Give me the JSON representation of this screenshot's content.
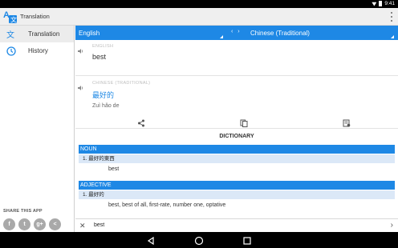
{
  "status": {
    "time": "9:41"
  },
  "app": {
    "title": "Translation"
  },
  "drawer": {
    "items": [
      {
        "label": "Translation",
        "icon": "translate-icon",
        "active": true
      },
      {
        "label": "History",
        "icon": "clock-icon",
        "active": false
      }
    ],
    "share_label": "SHARE THIS APP",
    "share_buttons": [
      {
        "icon": "facebook-icon",
        "glyph": "f"
      },
      {
        "icon": "twitter-icon",
        "glyph": "t"
      },
      {
        "icon": "googleplus-icon",
        "glyph": "g+"
      },
      {
        "icon": "share-icon",
        "glyph": "<"
      }
    ]
  },
  "languages": {
    "from": "English",
    "to": "Chinese (Traditional)",
    "swap": "‹ ›"
  },
  "source": {
    "label": "ENGLISH",
    "text": "best"
  },
  "target": {
    "label": "CHINESE (TRADITIONAL)",
    "text": "最好的",
    "pinyin": "Zuì hǎo de"
  },
  "dictionary": {
    "title": "DICTIONARY",
    "entries": [
      {
        "pos": "NOUN",
        "sense": "1. 最好的東西",
        "translations": "best"
      },
      {
        "pos": "ADJECTIVE",
        "sense": "1. 最好的",
        "translations": "best, best of all, first-rate, number one, optative"
      }
    ]
  },
  "input": {
    "value": "best"
  },
  "colors": {
    "accent": "#1e88e5",
    "sense_bg": "#dbe8f7"
  }
}
